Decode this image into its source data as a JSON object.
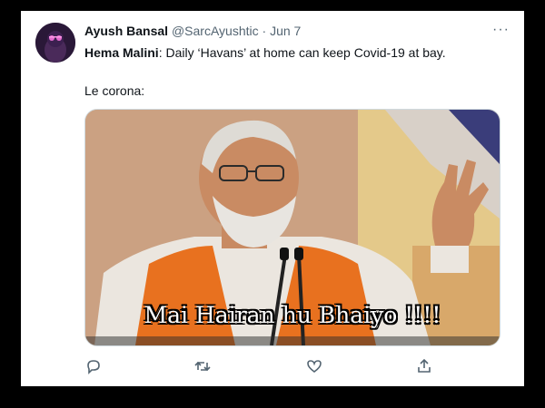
{
  "tweet": {
    "author_name": "Ayush Bansal",
    "handle": "@SarcAyushtic",
    "separator": "·",
    "date": "Jun 7",
    "more_glyph": "···",
    "quote_name": "Hema Malini",
    "quote_text": ": Daily ‘Havans’ at home can keep Covid-19 at bay.",
    "reply_text": "Le corona:",
    "media_caption": "Mai Hairan hu Bhaiyo !!!!"
  },
  "actions": [
    {
      "name": "reply",
      "icon": "reply-icon"
    },
    {
      "name": "retweet",
      "icon": "retweet-icon"
    },
    {
      "name": "like",
      "icon": "heart-icon"
    },
    {
      "name": "share",
      "icon": "share-icon"
    }
  ],
  "colors": {
    "text": "#0f1419",
    "muted": "#536471",
    "avatar_bg": "#2a1838",
    "vest": "#e8711f"
  }
}
